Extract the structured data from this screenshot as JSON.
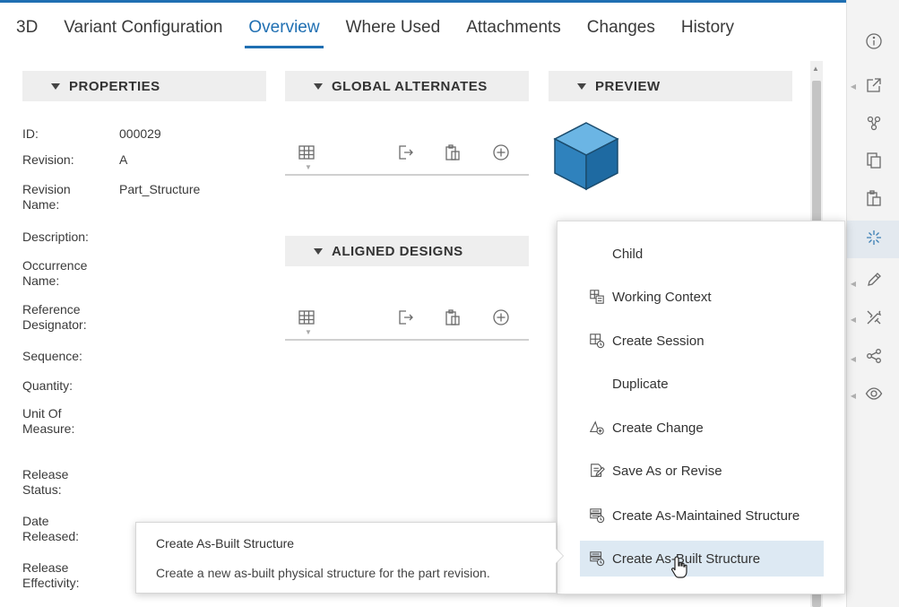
{
  "tabs": [
    {
      "label": "3D"
    },
    {
      "label": "Variant Configuration"
    },
    {
      "label": "Overview",
      "active": true
    },
    {
      "label": "Where Used"
    },
    {
      "label": "Attachments"
    },
    {
      "label": "Changes"
    },
    {
      "label": "History"
    }
  ],
  "sections": {
    "properties": "PROPERTIES",
    "global_alternates": "GLOBAL ALTERNATES",
    "preview": "PREVIEW",
    "aligned_designs": "ALIGNED DESIGNS"
  },
  "properties": [
    {
      "label": "ID:",
      "value": "000029"
    },
    {
      "label": "Revision:",
      "value": "A"
    },
    {
      "label": "Revision Name:",
      "value": "Part_Structure"
    },
    {
      "label": "Description:",
      "value": ""
    },
    {
      "label": "Occurrence Name:",
      "value": ""
    },
    {
      "label": "Reference Designator:",
      "value": ""
    },
    {
      "label": "Sequence:",
      "value": ""
    },
    {
      "label": "Quantity:",
      "value": ""
    },
    {
      "label": "Unit Of Measure:",
      "value": ""
    },
    {
      "label": "Release Status:",
      "value": ""
    },
    {
      "label": "Date Released:",
      "value": ""
    },
    {
      "label": "Release Effectivity:",
      "value": ""
    }
  ],
  "menu": {
    "items": [
      {
        "label": "Child",
        "icon": "none"
      },
      {
        "label": "Working Context",
        "icon": "working-context-icon"
      },
      {
        "label": "Create Session",
        "icon": "create-session-icon"
      },
      {
        "label": "Duplicate",
        "icon": "none"
      },
      {
        "label": "Create Change",
        "icon": "create-change-icon"
      },
      {
        "label": "Save As or Revise",
        "icon": "save-as-icon"
      },
      {
        "label": "Create As-Maintained Structure",
        "icon": "as-maintained-icon"
      },
      {
        "label": "Create As-Built Structure",
        "icon": "as-built-icon",
        "hovered": true
      }
    ]
  },
  "tooltip": {
    "title": "Create As-Built Structure",
    "description": "Create a new as-built physical structure for the part revision."
  },
  "colors": {
    "accent": "#1f6fb2",
    "cube": "#3d8fc6",
    "menu_hover": "#dde9f3",
    "header_bg": "#eeeeee"
  }
}
